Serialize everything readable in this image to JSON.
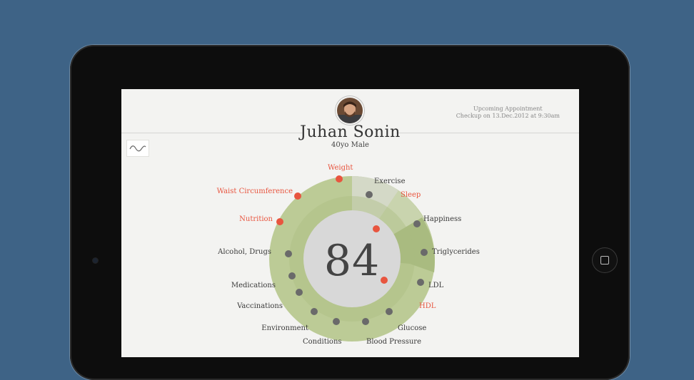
{
  "patient": {
    "name": "Juhan Sonin",
    "meta": "40yo Male"
  },
  "appointment": {
    "title": "Upcoming Appointment",
    "detail": "Checkup on 13.Dec.2012 at 9:30am"
  },
  "score": "84",
  "metrics": [
    {
      "key": "weight",
      "label": "Weight",
      "status": "alert"
    },
    {
      "key": "exercise",
      "label": "Exercise",
      "status": "ok"
    },
    {
      "key": "sleep",
      "label": "Sleep",
      "status": "alert"
    },
    {
      "key": "happiness",
      "label": "Happiness",
      "status": "ok"
    },
    {
      "key": "triglycerides",
      "label": "Triglycerides",
      "status": "ok"
    },
    {
      "key": "ldl",
      "label": "LDL",
      "status": "ok"
    },
    {
      "key": "hdl",
      "label": "HDL",
      "status": "alert"
    },
    {
      "key": "glucose",
      "label": "Glucose",
      "status": "ok"
    },
    {
      "key": "blood_pressure",
      "label": "Blood Pressure",
      "status": "ok"
    },
    {
      "key": "conditions",
      "label": "Conditions",
      "status": "ok"
    },
    {
      "key": "environment",
      "label": "Environment",
      "status": "ok"
    },
    {
      "key": "vaccinations",
      "label": "Vaccinations",
      "status": "ok"
    },
    {
      "key": "medications",
      "label": "Medications",
      "status": "ok"
    },
    {
      "key": "alcohol_drugs",
      "label": "Alcohol, Drugs",
      "status": "ok"
    },
    {
      "key": "nutrition",
      "label": "Nutrition",
      "status": "alert"
    },
    {
      "key": "waist",
      "label": "Waist Circumference",
      "status": "alert"
    }
  ],
  "colors": {
    "background": "#3e6386",
    "alert": "#e8553f",
    "ok_dot": "#6a6a6a",
    "ring": "#bccb96",
    "ring_dark": "#a9bb80",
    "center": "#d8d8d8"
  },
  "icons": {
    "trend": "trend-wave-icon",
    "home": "home-button-icon",
    "camera": "camera-icon"
  }
}
